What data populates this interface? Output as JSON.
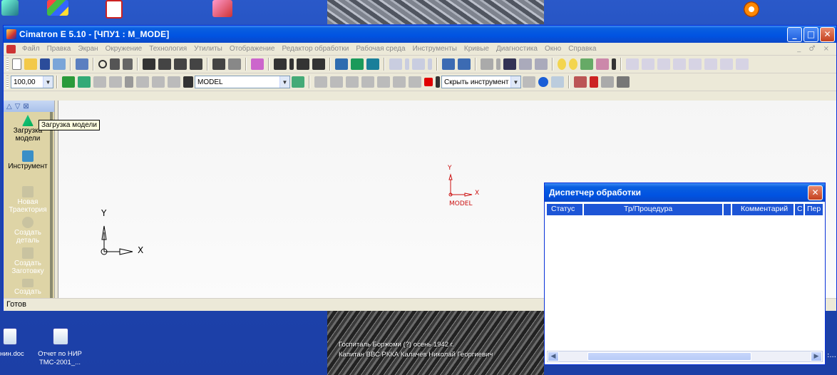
{
  "app": {
    "title": "Cimatron E 5.10 - [ЧПУ1 : M_MODE]"
  },
  "window_controls": {
    "minimize": "_",
    "maximize": "□",
    "close": "✕"
  },
  "menu": {
    "items": [
      "Файл",
      "Правка",
      "Экран",
      "Окружение",
      "Технология",
      "Утилиты",
      "Отображение",
      "Редактор обработки",
      "Рабочая среда",
      "Инструменты",
      "Кривые",
      "Диагностика",
      "Окно",
      "Справка"
    ],
    "right_controls": "_ ♂ ×"
  },
  "toolbar2": {
    "zoom_value": "100,00",
    "model_select": "MODEL",
    "tool_select": "Скрыть инструмент",
    "color_swatch": "#e00000"
  },
  "wizard": {
    "items": [
      {
        "label": "Загрузка модели",
        "state": "active"
      },
      {
        "label": "Инструмент",
        "state": "active"
      },
      {
        "label": "Новая Траектория",
        "state": "dim"
      },
      {
        "label": "Создать деталь",
        "state": "dim"
      },
      {
        "label": "Создать Заготовку",
        "state": "dim"
      },
      {
        "label": "Создать",
        "state": "dim"
      }
    ]
  },
  "tooltip": "Загрузка модели",
  "viewport": {
    "model_axes": {
      "y": "Y",
      "x": "X",
      "label": "MODEL",
      "color": "#cc1111"
    },
    "world_axes": {
      "y": "Y",
      "x": "X"
    }
  },
  "status": "Готов",
  "manager": {
    "title": "Диспетчер обработки",
    "columns": [
      "Статус",
      "Тр/Процедура",
      "",
      "Комментарий",
      "С",
      "Пер"
    ]
  },
  "desktop": {
    "icons": [
      {
        "label": "нин.doc"
      },
      {
        "label": "Отчет по НИР ТМС-2001_..."
      }
    ],
    "caption": [
      "Госпиталь Боржоми (?) осень 1942 г.",
      "Капитан ВВС РККА  Калачёв Николай Георгиевич"
    ],
    "edge_text": ":..."
  }
}
